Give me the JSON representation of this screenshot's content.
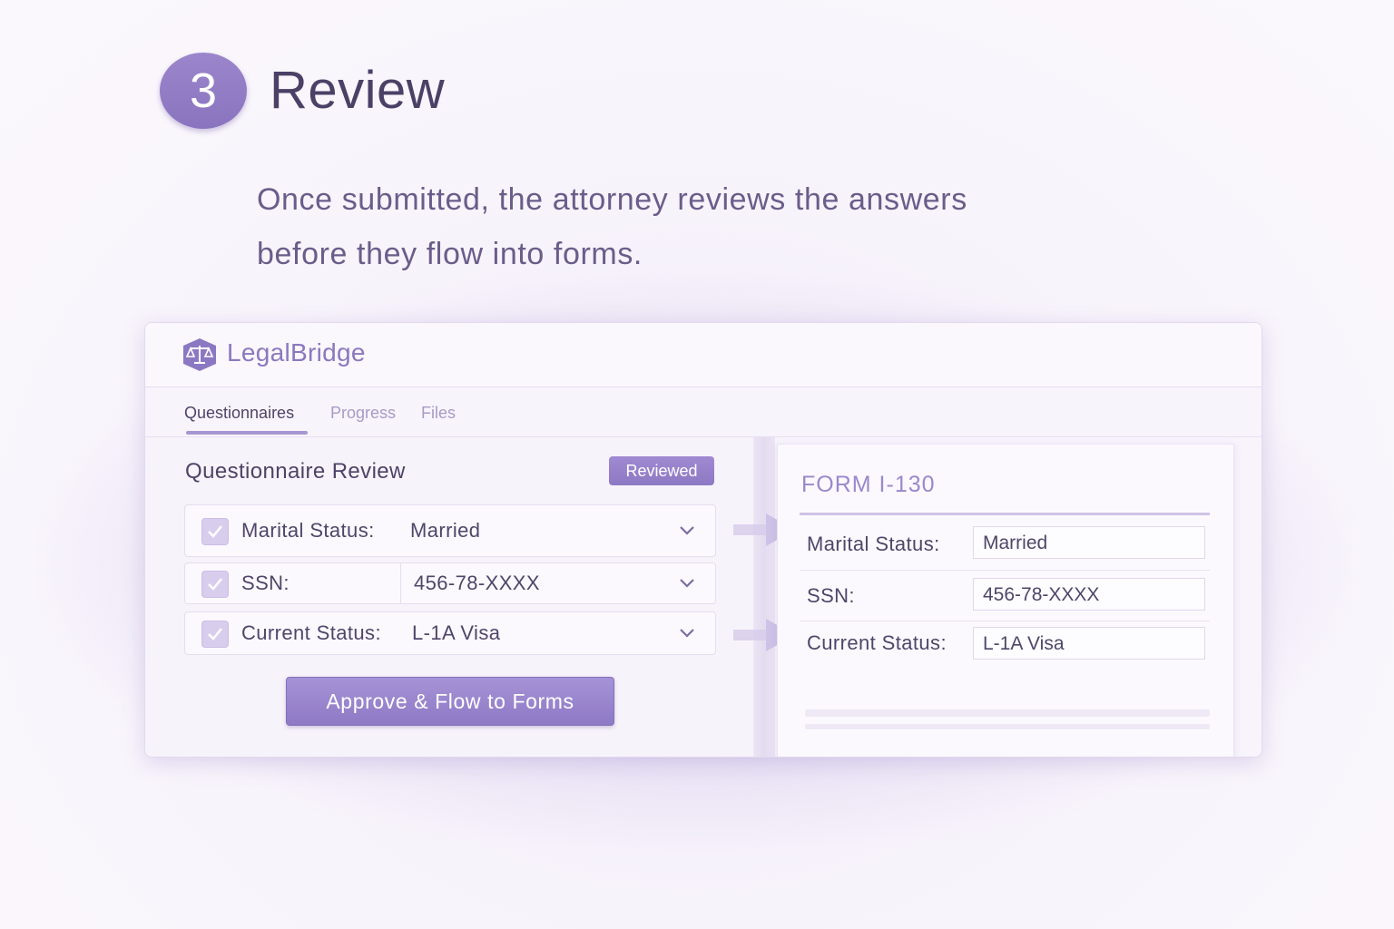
{
  "step": {
    "number": "3",
    "title": "Review"
  },
  "intro": {
    "line1": "Once submitted, the attorney reviews the answers",
    "line2": "before they flow into forms."
  },
  "app": {
    "brand": "LegalBridge",
    "tabs": [
      {
        "label": "Questionnaires",
        "active": true
      },
      {
        "label": "Progress",
        "active": false
      },
      {
        "label": "Files",
        "active": false
      }
    ]
  },
  "review": {
    "title": "Questionnaire Review",
    "badge": "Reviewed",
    "rows": [
      {
        "label": "Marital Status:",
        "value": "Married",
        "checked": true
      },
      {
        "label": "SSN:",
        "value": "456-78-XXXX",
        "checked": true
      },
      {
        "label": "Current Status:",
        "value": "L-1A Visa",
        "checked": true
      }
    ],
    "approve_label": "Approve & Flow to Forms"
  },
  "form": {
    "title": "FORM I-130",
    "fields": [
      {
        "label": "Marital Status:",
        "value": "Married"
      },
      {
        "label": "SSN:",
        "value": "456-78-XXXX"
      },
      {
        "label": "Current Status:",
        "value": "L-1A Visa"
      }
    ]
  },
  "colors": {
    "accent": "#8e79c5",
    "badge_bg": "#9883cc",
    "text": "#4f4669",
    "form_title": "#9a88cc"
  }
}
